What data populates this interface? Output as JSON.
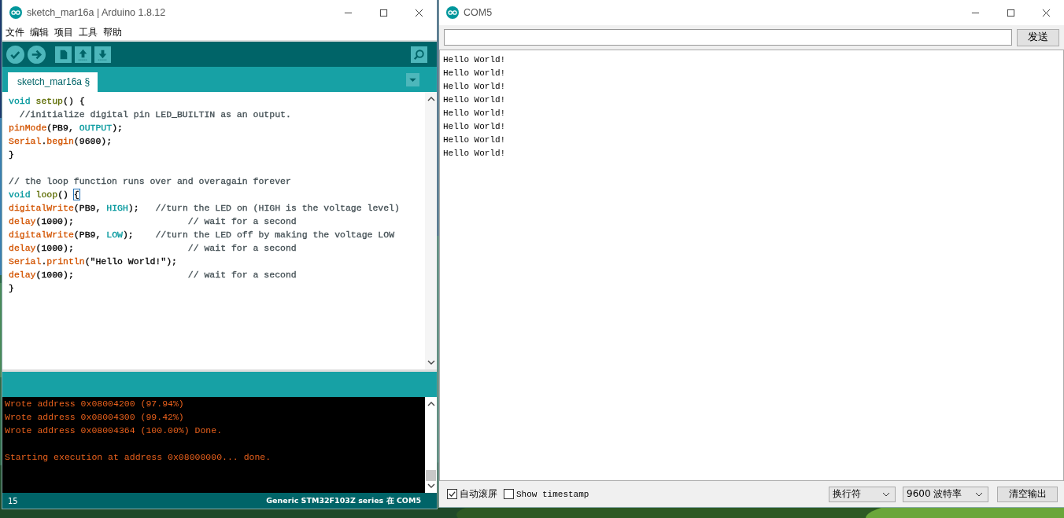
{
  "arduino_window": {
    "title": "sketch_mar16a | Arduino 1.8.12",
    "menu": [
      "文件",
      "编辑",
      "项目",
      "工具",
      "帮助"
    ],
    "tabs": [
      {
        "label": "sketch_mar16a §",
        "selected": true
      }
    ],
    "code_lines": [
      {
        "tokens": [
          {
            "t": "void ",
            "color": "#00979c"
          },
          {
            "t": "setup",
            "color": "#5e6d03"
          },
          {
            "t": "() {"
          }
        ]
      },
      {
        "tokens": [
          {
            "t": "  //initialize digital pin LED_BUILTIN as an output.",
            "color": "#434f54"
          }
        ]
      },
      {
        "tokens": [
          {
            "t": "pinMode",
            "color": "#d35400"
          },
          {
            "t": "(PB9, "
          },
          {
            "t": "OUTPUT",
            "color": "#00979c"
          },
          {
            "t": ");"
          }
        ]
      },
      {
        "tokens": [
          {
            "t": "Serial",
            "color": "#d35400"
          },
          {
            "t": "."
          },
          {
            "t": "begin",
            "color": "#d35400"
          },
          {
            "t": "(9600);"
          }
        ]
      },
      {
        "tokens": [
          {
            "t": "}"
          }
        ]
      },
      {
        "gap_before": true,
        "tokens": [
          {
            "t": "// the loop function runs over and overagain forever",
            "color": "#434f54"
          }
        ]
      },
      {
        "tokens": [
          {
            "t": "void ",
            "color": "#00979c"
          },
          {
            "t": "loop",
            "color": "#5e6d03"
          },
          {
            "t": "() "
          },
          {
            "t": "{",
            "cursor": true
          }
        ]
      },
      {
        "tokens": [
          {
            "t": "digitalWrite",
            "color": "#d35400"
          },
          {
            "t": "(PB9, "
          },
          {
            "t": "HIGH",
            "color": "#00979c"
          },
          {
            "t": ");   "
          },
          {
            "t": "//turn the LED on (HIGH is the voltage level)",
            "color": "#434f54"
          }
        ]
      },
      {
        "tokens": [
          {
            "t": "delay",
            "color": "#d35400"
          },
          {
            "t": "(1000);                     "
          },
          {
            "t": "// wait for a second",
            "color": "#434f54"
          }
        ]
      },
      {
        "tokens": [
          {
            "t": "digitalWrite",
            "color": "#d35400"
          },
          {
            "t": "(PB9, "
          },
          {
            "t": "LOW",
            "color": "#00979c"
          },
          {
            "t": ");    "
          },
          {
            "t": "//turn the LED off by making the voltage LOW",
            "color": "#434f54"
          }
        ]
      },
      {
        "tokens": [
          {
            "t": "delay",
            "color": "#d35400"
          },
          {
            "t": "(1000);                     "
          },
          {
            "t": "// wait for a second",
            "color": "#434f54"
          }
        ]
      },
      {
        "tokens": [
          {
            "t": "Serial",
            "color": "#d35400"
          },
          {
            "t": "."
          },
          {
            "t": "println",
            "color": "#d35400"
          },
          {
            "t": "(\"Hello World!\");"
          }
        ]
      },
      {
        "tokens": [
          {
            "t": "delay",
            "color": "#d35400"
          },
          {
            "t": "(1000);                     "
          },
          {
            "t": "// wait for a second",
            "color": "#434f54"
          }
        ]
      },
      {
        "tokens": [
          {
            "t": "}"
          }
        ]
      }
    ],
    "console_lines": [
      {
        "text": "Wrote address 0x08004200 (97.94%)"
      },
      {
        "text": "Wrote address 0x08004300 (99.42%)"
      },
      {
        "text": "Wrote address 0x08004364 (100.00%) Done."
      },
      {
        "gap_before": true,
        "text": "Starting execution at address 0x08000000... done."
      }
    ],
    "status_bar": {
      "line": "15",
      "board": "Generic STM32F103Z series 在 COM5"
    }
  },
  "serial_monitor": {
    "title": "COM5",
    "send_button": "发送",
    "output_lines": [
      "Hello World!",
      "Hello World!",
      "Hello World!",
      "Hello World!",
      "Hello World!",
      "Hello World!",
      "Hello World!",
      "Hello World!"
    ],
    "options": [
      {
        "label": "自动滚屏",
        "checked": true,
        "kind": "sans"
      },
      {
        "label": "Show timestamp",
        "checked": false,
        "kind": "mono"
      }
    ],
    "line_ending": "换行符",
    "baud_rate": "9600 波特率",
    "clear_button": "清空输出"
  }
}
